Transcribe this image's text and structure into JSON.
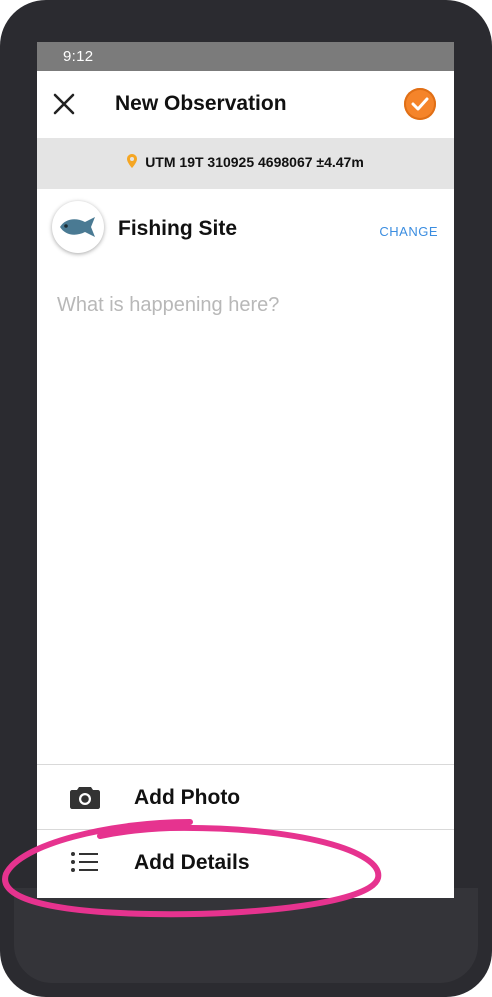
{
  "status_bar": {
    "time": "9:12"
  },
  "app_bar": {
    "title": "New Observation",
    "close_icon": "close-icon",
    "confirm_icon": "checkmark-icon"
  },
  "location": {
    "text": "UTM 19T 310925 4698067 ±4.47m",
    "icon": "location-pin-icon"
  },
  "preset": {
    "name": "Fishing Site",
    "icon": "fish-icon",
    "change_label": "CHANGE"
  },
  "notes": {
    "placeholder": "What is happening here?"
  },
  "actions": [
    {
      "label": "Add Photo",
      "icon": "camera-icon"
    },
    {
      "label": "Add Details",
      "icon": "list-icon"
    }
  ],
  "colors": {
    "accent": "#f5842a",
    "link": "#3b8de0",
    "pin": "#f5a623",
    "highlight": "#e6338f",
    "device": "#2b2b30",
    "status_bar": "#7b7b7b"
  }
}
